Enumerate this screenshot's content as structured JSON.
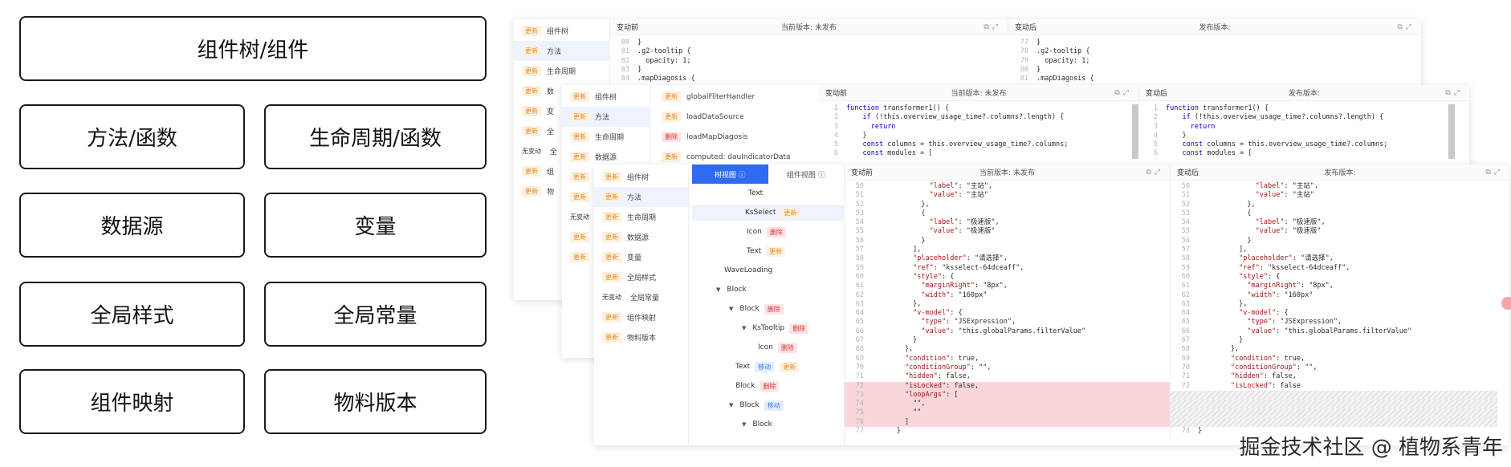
{
  "categories": {
    "component_tree": "组件树/组件",
    "methods": "方法/函数",
    "lifecycle": "生命周期/函数",
    "datasource": "数据源",
    "variables": "变量",
    "global_styles": "全局样式",
    "global_constants": "全局常量",
    "component_mapping": "组件映射",
    "material_version": "物料版本"
  },
  "panel1": {
    "nav": [
      {
        "tag": "更新",
        "label": "组件树"
      },
      {
        "tag": "更新",
        "label": "方法"
      },
      {
        "tag": "更新",
        "label": "生命周期"
      },
      {
        "tag": "更新",
        "label": "数"
      },
      {
        "tag": "更新",
        "label": "变"
      },
      {
        "tag": "更新",
        "label": "全"
      },
      {
        "tag": "无变动",
        "label": "全"
      },
      {
        "tag": "更新",
        "label": "组"
      },
      {
        "tag": "更新",
        "label": "物"
      }
    ],
    "left_title": "变动前",
    "left_version": "当前版本: 未发布",
    "right_title": "变动后",
    "right_version": "发布版本:",
    "left_code": [
      {
        "ln": "80",
        "text": "}"
      },
      {
        "ln": "81",
        "text": ".g2-tooltip {"
      },
      {
        "ln": "82",
        "text": "  opacity: 1;"
      },
      {
        "ln": "83",
        "text": "}"
      },
      {
        "ln": "84",
        "text": ".mapDiagosis {"
      }
    ],
    "right_code": [
      {
        "ln": "77",
        "text": "}"
      },
      {
        "ln": "78",
        "text": ".g2-tooltip {"
      },
      {
        "ln": "79",
        "text": "  opacity: 1;"
      },
      {
        "ln": "80",
        "text": "}"
      },
      {
        "ln": "81",
        "text": ".mapDiagosis {"
      }
    ]
  },
  "panel2": {
    "nav": [
      {
        "tag": "更新",
        "label": "组件树"
      },
      {
        "tag": "更新",
        "label": "方法"
      },
      {
        "tag": "更新",
        "label": "生命周期"
      },
      {
        "tag": "更新",
        "label": "数据源"
      },
      {
        "tag": "更新",
        "label": ""
      },
      {
        "tag": "更新",
        "label": ""
      },
      {
        "tag": "无变动",
        "label": ""
      },
      {
        "tag": "更新",
        "label": ""
      },
      {
        "tag": "更新",
        "label": ""
      }
    ],
    "methods": [
      {
        "tag": "更新",
        "tag_type": "upd",
        "label": "globalFilterHandler"
      },
      {
        "tag": "更新",
        "tag_type": "upd",
        "label": "loadDataSource"
      },
      {
        "tag": "删除",
        "tag_type": "del",
        "label": "loadMapDiagosis"
      },
      {
        "tag": "更新",
        "tag_type": "upd",
        "label": "computed: dauIndicatorData"
      }
    ],
    "left_title": "变动前",
    "left_version": "当前版本: 未发布",
    "right_title": "变动后",
    "right_version": "发布版本:",
    "left_code": [
      {
        "ln": "1",
        "text": "function transformer1() {"
      },
      {
        "ln": "2",
        "text": "    if (!this.overview_usage_time?.columns?.length) {"
      },
      {
        "ln": "3",
        "text": "      return"
      },
      {
        "ln": "4",
        "text": "    }"
      },
      {
        "ln": "5",
        "text": "    const columns = this.overview_usage_time?.columns;"
      },
      {
        "ln": "6",
        "text": "    const modules = ["
      }
    ],
    "right_code": [
      {
        "ln": "1",
        "text": "function transformer1() {"
      },
      {
        "ln": "2",
        "text": "    if (!this.overview_usage_time?.columns?.length) {"
      },
      {
        "ln": "3",
        "text": "      return"
      },
      {
        "ln": "4",
        "text": "    }"
      },
      {
        "ln": "5",
        "text": "    const columns = this.overview_usage_time?.columns;"
      },
      {
        "ln": "6",
        "text": "    const modules = ["
      }
    ]
  },
  "panel3": {
    "nav": [
      {
        "tag": "更新",
        "label": "组件树"
      },
      {
        "tag": "更新",
        "label": "方法"
      },
      {
        "tag": "更新",
        "label": "生命周期"
      },
      {
        "tag": "更新",
        "label": "数据源"
      },
      {
        "tag": "更新",
        "label": "变量"
      },
      {
        "tag": "更新",
        "label": "全局样式"
      },
      {
        "tag": "无变动",
        "label": "全局常量"
      },
      {
        "tag": "更新",
        "label": "组件映射"
      },
      {
        "tag": "更新",
        "label": "物料版本"
      }
    ],
    "tab_tree": "树视图 ⓘ",
    "tab_component": "组件视图 ⓘ",
    "tree": [
      {
        "label": "Text",
        "tag": "",
        "tag_type": "",
        "indent": 60,
        "caret": false,
        "hl": false
      },
      {
        "label": "KsSelect",
        "tag": "更新",
        "tag_type": "upd",
        "indent": 56,
        "caret": false,
        "hl": true
      },
      {
        "label": "Icon",
        "tag": "删除",
        "tag_type": "del",
        "indent": 58,
        "caret": false,
        "hl": false
      },
      {
        "label": "Text",
        "tag": "更新",
        "tag_type": "upd",
        "indent": 58,
        "caret": false,
        "hl": false
      },
      {
        "label": "WaveLoading",
        "tag": "",
        "tag_type": "",
        "indent": 30,
        "caret": false,
        "hl": false
      },
      {
        "label": "Block",
        "tag": "",
        "tag_type": "",
        "indent": 20,
        "caret": true,
        "hl": false
      },
      {
        "label": "Block",
        "tag": "删除",
        "tag_type": "del",
        "indent": 36,
        "caret": true,
        "hl": false
      },
      {
        "label": "KsTooltip",
        "tag": "删除",
        "tag_type": "del",
        "indent": 52,
        "caret": true,
        "hl": false
      },
      {
        "label": "Icon",
        "tag": "删除",
        "tag_type": "del",
        "indent": 72,
        "caret": false,
        "hl": false
      },
      {
        "label": "Text",
        "tag": "移动",
        "tag_type": "mov",
        "tag2": "更新",
        "indent": 44,
        "caret": false,
        "hl": false
      },
      {
        "label": "Block",
        "tag": "删除",
        "tag_type": "del",
        "indent": 44,
        "caret": false,
        "hl": false
      },
      {
        "label": "Block",
        "tag": "移动",
        "tag_type": "mov",
        "indent": 36,
        "caret": true,
        "hl": false
      },
      {
        "label": "Block",
        "tag": "",
        "tag_type": "",
        "indent": 52,
        "caret": true,
        "hl": false
      }
    ],
    "left_title": "变动前",
    "left_version": "当前版本: 未发布",
    "right_title": "变动后",
    "right_version": "发布版本:",
    "left_code": [
      {
        "ln": "50",
        "text": "              \"label\": \"主站\",",
        "cls": ""
      },
      {
        "ln": "51",
        "text": "              \"value\": \"主站\"",
        "cls": ""
      },
      {
        "ln": "52",
        "text": "            },",
        "cls": ""
      },
      {
        "ln": "53",
        "text": "            {",
        "cls": ""
      },
      {
        "ln": "54",
        "text": "              \"label\": \"极速版\",",
        "cls": ""
      },
      {
        "ln": "55",
        "text": "              \"value\": \"极速版\"",
        "cls": ""
      },
      {
        "ln": "56",
        "text": "            }",
        "cls": ""
      },
      {
        "ln": "57",
        "text": "          ],",
        "cls": ""
      },
      {
        "ln": "58",
        "text": "          \"placeholder\": \"请选择\",",
        "cls": ""
      },
      {
        "ln": "59",
        "text": "          \"ref\": \"ksselect-64dceaff\",",
        "cls": ""
      },
      {
        "ln": "60",
        "text": "          \"style\": {",
        "cls": ""
      },
      {
        "ln": "61",
        "text": "            \"marginRight\": \"8px\",",
        "cls": ""
      },
      {
        "ln": "62",
        "text": "            \"width\": \"160px\"",
        "cls": ""
      },
      {
        "ln": "63",
        "text": "          },",
        "cls": ""
      },
      {
        "ln": "64",
        "text": "          \"v-model\": {",
        "cls": ""
      },
      {
        "ln": "65",
        "text": "            \"type\": \"JSExpression\",",
        "cls": ""
      },
      {
        "ln": "66",
        "text": "            \"value\": \"this.globalParams.filterValue\"",
        "cls": ""
      },
      {
        "ln": "67",
        "text": "          }",
        "cls": ""
      },
      {
        "ln": "68",
        "text": "        },",
        "cls": ""
      },
      {
        "ln": "69",
        "text": "        \"condition\": true,",
        "cls": ""
      },
      {
        "ln": "70",
        "text": "        \"conditionGroup\": \"\",",
        "cls": ""
      },
      {
        "ln": "71",
        "text": "        \"hidden\": false,",
        "cls": ""
      },
      {
        "ln": "72",
        "text": "        \"isLocked\": false,",
        "cls": "delbg"
      },
      {
        "ln": "73",
        "text": "        \"loopArgs\": [",
        "cls": "delbg"
      },
      {
        "ln": "74",
        "text": "          \"\",",
        "cls": "delbg"
      },
      {
        "ln": "75",
        "text": "          \"\"",
        "cls": "delbg"
      },
      {
        "ln": "76",
        "text": "        ]",
        "cls": "delbg"
      },
      {
        "ln": "77",
        "text": "      }",
        "cls": ""
      }
    ],
    "right_code": [
      {
        "ln": "50",
        "text": "              \"label\": \"主站\",",
        "cls": ""
      },
      {
        "ln": "51",
        "text": "              \"value\": \"主站\"",
        "cls": ""
      },
      {
        "ln": "52",
        "text": "            },",
        "cls": ""
      },
      {
        "ln": "53",
        "text": "            {",
        "cls": ""
      },
      {
        "ln": "54",
        "text": "              \"label\": \"极速版\",",
        "cls": ""
      },
      {
        "ln": "55",
        "text": "              \"value\": \"极速版\"",
        "cls": ""
      },
      {
        "ln": "56",
        "text": "            }",
        "cls": ""
      },
      {
        "ln": "57",
        "text": "          ],",
        "cls": ""
      },
      {
        "ln": "58",
        "text": "          \"placeholder\": \"请选择\",",
        "cls": ""
      },
      {
        "ln": "59",
        "text": "          \"ref\": \"ksselect-64dceaff\",",
        "cls": ""
      },
      {
        "ln": "60",
        "text": "          \"style\": {",
        "cls": ""
      },
      {
        "ln": "61",
        "text": "            \"marginRight\": \"8px\",",
        "cls": ""
      },
      {
        "ln": "62",
        "text": "            \"width\": \"160px\"",
        "cls": ""
      },
      {
        "ln": "63",
        "text": "          },",
        "cls": ""
      },
      {
        "ln": "64",
        "text": "          \"v-model\": {",
        "cls": ""
      },
      {
        "ln": "65",
        "text": "            \"type\": \"JSExpression\",",
        "cls": ""
      },
      {
        "ln": "66",
        "text": "            \"value\": \"this.globalParams.filterValue\"",
        "cls": ""
      },
      {
        "ln": "67",
        "text": "          }",
        "cls": ""
      },
      {
        "ln": "68",
        "text": "        },",
        "cls": ""
      },
      {
        "ln": "69",
        "text": "        \"condition\": true,",
        "cls": ""
      },
      {
        "ln": "70",
        "text": "        \"conditionGroup\": \"\",",
        "cls": ""
      },
      {
        "ln": "71",
        "text": "        \"hidden\": false,",
        "cls": ""
      },
      {
        "ln": "72",
        "text": "        \"isLocked\": false",
        "cls": ""
      },
      {
        "ln": "",
        "text": "",
        "cls": "hatch"
      },
      {
        "ln": "",
        "text": "",
        "cls": "hatch"
      },
      {
        "ln": "",
        "text": "",
        "cls": "hatch"
      },
      {
        "ln": "",
        "text": "",
        "cls": "hatch"
      },
      {
        "ln": "73",
        "text": "}",
        "cls": ""
      }
    ]
  },
  "watermark": "掘金技术社区 @ 植物系青年",
  "colors": {
    "accent": "#2f6bf0",
    "update_tag": "#e58a1f",
    "delete_tag": "#d9363e",
    "move_tag": "#3a7af0",
    "diff_removed_bg": "#f9d6d9"
  }
}
